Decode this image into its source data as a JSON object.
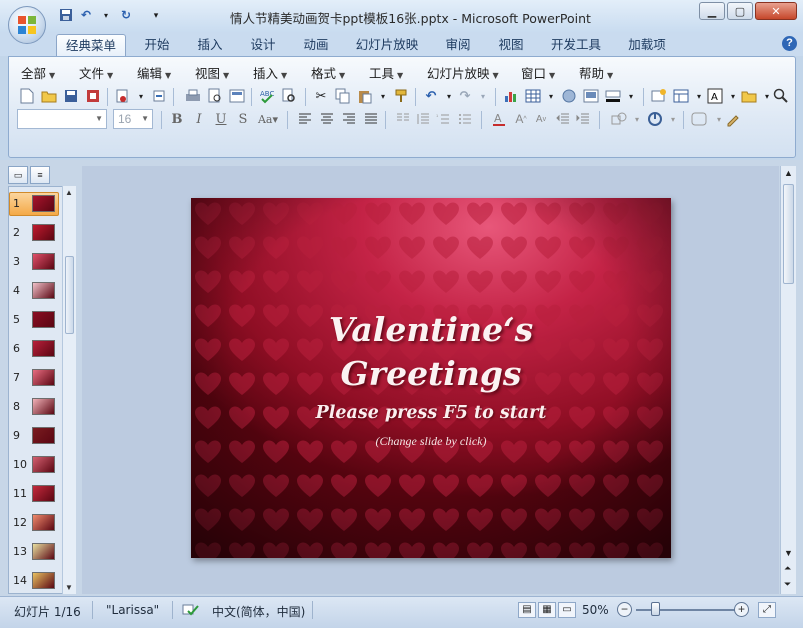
{
  "window": {
    "title": "情人节精美动画贺卡ppt模板16张.pptx - Microsoft PowerPoint",
    "controls": [
      "minimize",
      "maximize",
      "close"
    ]
  },
  "quick_access": [
    "save-icon",
    "undo-icon",
    "redo-icon",
    "customize-icon"
  ],
  "tabs": [
    {
      "label": "经典菜单",
      "active": true
    },
    {
      "label": "开始"
    },
    {
      "label": "插入"
    },
    {
      "label": "设计"
    },
    {
      "label": "动画"
    },
    {
      "label": "幻灯片放映"
    },
    {
      "label": "审阅"
    },
    {
      "label": "视图"
    },
    {
      "label": "开发工具"
    },
    {
      "label": "加载项"
    }
  ],
  "menus": [
    "全部",
    "文件",
    "编辑",
    "视图",
    "插入",
    "格式",
    "工具",
    "幻灯片放映",
    "窗口",
    "帮助"
  ],
  "format": {
    "font_name": "",
    "font_size": "16"
  },
  "thumbnails": [
    {
      "num": "1",
      "selected": true,
      "color": "#a8142c"
    },
    {
      "num": "2",
      "color": "#c01a2e"
    },
    {
      "num": "3",
      "color": "#e0506a"
    },
    {
      "num": "4",
      "color": "#f0c0c8"
    },
    {
      "num": "5",
      "color": "#8a0e22"
    },
    {
      "num": "6",
      "color": "#b8203a"
    },
    {
      "num": "7",
      "color": "#e86c80"
    },
    {
      "num": "8",
      "color": "#f1b2b8"
    },
    {
      "num": "9",
      "color": "#7a1c20"
    },
    {
      "num": "10",
      "color": "#d46070"
    },
    {
      "num": "11",
      "color": "#c42a3c"
    },
    {
      "num": "12",
      "color": "#f08a6c"
    },
    {
      "num": "13",
      "color": "#e8dfa0"
    },
    {
      "num": "14",
      "color": "#e8c060"
    }
  ],
  "slide": {
    "title_line1": "Valentine‘s",
    "title_line2": "Greetings",
    "subtitle": "Please press F5 to start",
    "note": "(Change slide by click)",
    "bg_color": "#b0182f",
    "heart_color": "#c92a44"
  },
  "status": {
    "slide_indicator": "幻灯片 1/16",
    "theme": "\"Larissa\"",
    "language": "中文(简体，中国)",
    "zoom": "50%"
  }
}
